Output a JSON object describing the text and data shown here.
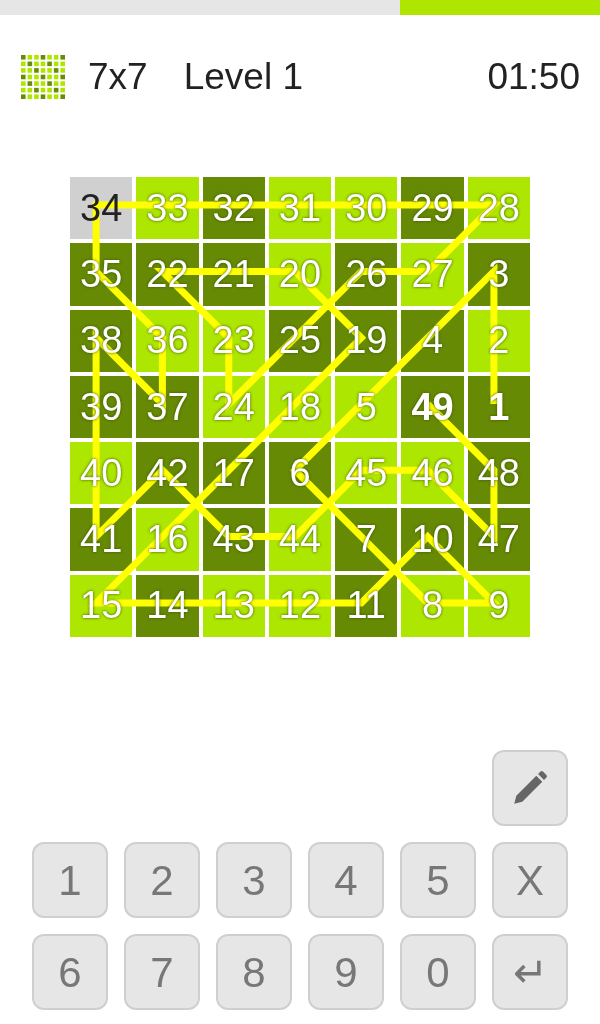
{
  "progress": {
    "level": 0.333
  },
  "header": {
    "size": "7x7",
    "level": "Level 1",
    "timer": "01:50"
  },
  "grid": [
    [
      {
        "n": "34",
        "selected": true,
        "given": false
      },
      {
        "n": "33",
        "color": "#ade600",
        "selected": false,
        "given": false
      },
      {
        "n": "32",
        "color": "#668a04",
        "selected": false,
        "given": false
      },
      {
        "n": "31",
        "color": "#ade600",
        "selected": false,
        "given": false
      },
      {
        "n": "30",
        "color": "#ade600",
        "selected": false,
        "given": false
      },
      {
        "n": "29",
        "color": "#668a04",
        "selected": false,
        "given": false
      },
      {
        "n": "28",
        "color": "#ade600",
        "selected": false,
        "given": false
      }
    ],
    [
      {
        "n": "35",
        "color": "#668a04",
        "selected": false,
        "given": false
      },
      {
        "n": "22",
        "color": "#668a04",
        "selected": false,
        "given": false
      },
      {
        "n": "21",
        "color": "#668a04",
        "selected": false,
        "given": false
      },
      {
        "n": "20",
        "color": "#ade600",
        "selected": false,
        "given": false
      },
      {
        "n": "26",
        "color": "#668a04",
        "selected": false,
        "given": false
      },
      {
        "n": "27",
        "color": "#ade600",
        "selected": false,
        "given": false
      },
      {
        "n": "3",
        "color": "#668a04",
        "selected": false,
        "given": false
      }
    ],
    [
      {
        "n": "38",
        "color": "#668a04",
        "selected": false,
        "given": false
      },
      {
        "n": "36",
        "color": "#ade600",
        "selected": false,
        "given": false
      },
      {
        "n": "23",
        "color": "#ade600",
        "selected": false,
        "given": false
      },
      {
        "n": "25",
        "color": "#668a04",
        "selected": false,
        "given": false
      },
      {
        "n": "19",
        "color": "#668a04",
        "selected": false,
        "given": false
      },
      {
        "n": "4",
        "color": "#668a04",
        "selected": false,
        "given": false
      },
      {
        "n": "2",
        "color": "#ade600",
        "selected": false,
        "given": false
      }
    ],
    [
      {
        "n": "39",
        "color": "#668a04",
        "selected": false,
        "given": false
      },
      {
        "n": "37",
        "color": "#668a04",
        "selected": false,
        "given": false
      },
      {
        "n": "24",
        "color": "#ade600",
        "selected": false,
        "given": false
      },
      {
        "n": "18",
        "color": "#ade600",
        "selected": false,
        "given": false
      },
      {
        "n": "5",
        "color": "#ade600",
        "selected": false,
        "given": false
      },
      {
        "n": "49",
        "color": "#668a04",
        "selected": false,
        "given": true
      },
      {
        "n": "1",
        "color": "#668a04",
        "selected": false,
        "given": true
      }
    ],
    [
      {
        "n": "40",
        "color": "#ade600",
        "selected": false,
        "given": false
      },
      {
        "n": "42",
        "color": "#668a04",
        "selected": false,
        "given": false
      },
      {
        "n": "17",
        "color": "#668a04",
        "selected": false,
        "given": false
      },
      {
        "n": "6",
        "color": "#668a04",
        "selected": false,
        "given": false
      },
      {
        "n": "45",
        "color": "#ade600",
        "selected": false,
        "given": false
      },
      {
        "n": "46",
        "color": "#ade600",
        "selected": false,
        "given": false
      },
      {
        "n": "48",
        "color": "#668a04",
        "selected": false,
        "given": false
      }
    ],
    [
      {
        "n": "41",
        "color": "#668a04",
        "selected": false,
        "given": false
      },
      {
        "n": "16",
        "color": "#ade600",
        "selected": false,
        "given": false
      },
      {
        "n": "43",
        "color": "#668a04",
        "selected": false,
        "given": false
      },
      {
        "n": "44",
        "color": "#ade600",
        "selected": false,
        "given": false
      },
      {
        "n": "7",
        "color": "#668a04",
        "selected": false,
        "given": false
      },
      {
        "n": "10",
        "color": "#668a04",
        "selected": false,
        "given": false
      },
      {
        "n": "47",
        "color": "#668a04",
        "selected": false,
        "given": false
      }
    ],
    [
      {
        "n": "15",
        "color": "#ade600",
        "selected": false,
        "given": false
      },
      {
        "n": "14",
        "color": "#668a04",
        "selected": false,
        "given": false
      },
      {
        "n": "13",
        "color": "#ade600",
        "selected": false,
        "given": false
      },
      {
        "n": "12",
        "color": "#ade600",
        "selected": false,
        "given": false
      },
      {
        "n": "11",
        "color": "#668a04",
        "selected": false,
        "given": false
      },
      {
        "n": "8",
        "color": "#ade600",
        "selected": false,
        "given": false
      },
      {
        "n": "9",
        "color": "#ade600",
        "selected": false,
        "given": false
      }
    ]
  ],
  "keypad": [
    [
      {
        "kind": "pencil"
      }
    ],
    [
      {
        "kind": "key",
        "label": "1"
      },
      {
        "kind": "key",
        "label": "2"
      },
      {
        "kind": "key",
        "label": "3"
      },
      {
        "kind": "key",
        "label": "4"
      },
      {
        "kind": "key",
        "label": "5"
      },
      {
        "kind": "key",
        "label": "X"
      }
    ],
    [
      {
        "kind": "key",
        "label": "6"
      },
      {
        "kind": "key",
        "label": "7"
      },
      {
        "kind": "key",
        "label": "8"
      },
      {
        "kind": "key",
        "label": "9"
      },
      {
        "kind": "key",
        "label": "0"
      },
      {
        "kind": "key",
        "label": "↵"
      }
    ]
  ]
}
